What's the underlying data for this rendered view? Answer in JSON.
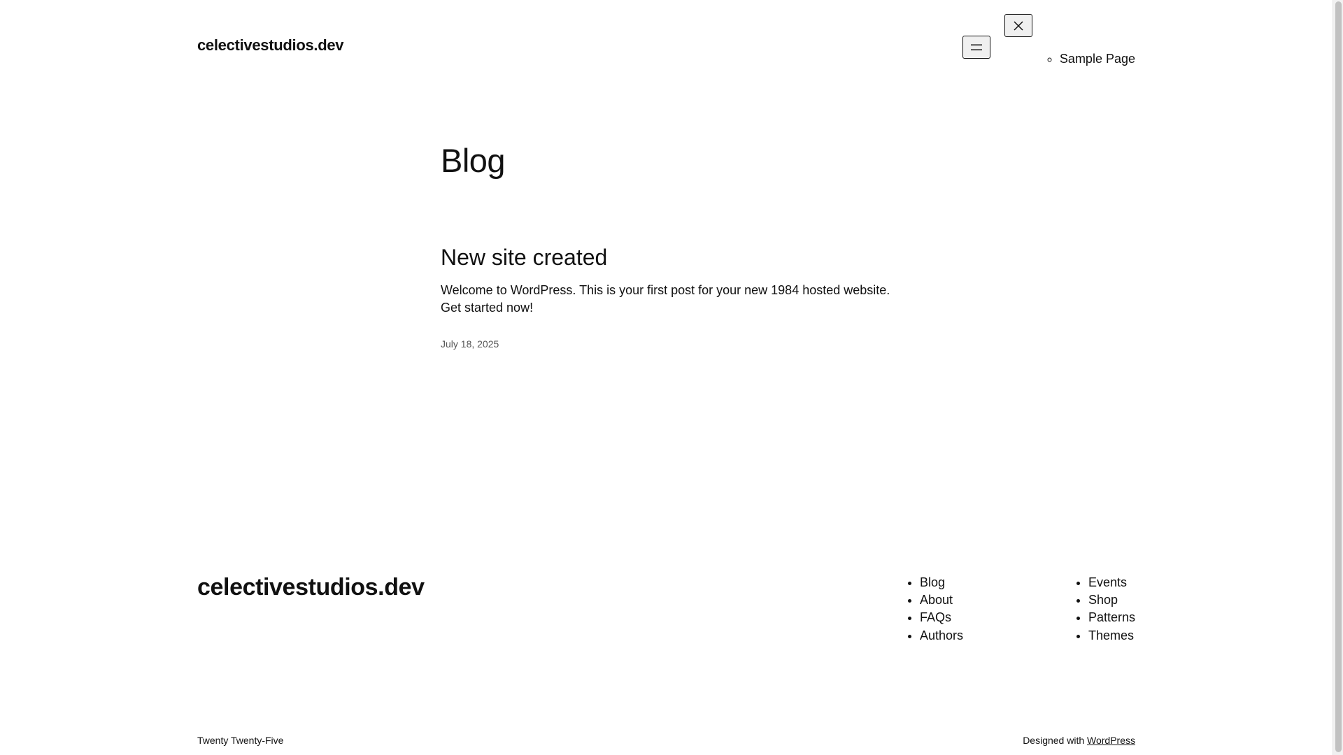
{
  "header": {
    "site_title": "celectivestudios.dev",
    "overlay_menu": [
      {
        "label": "Sample Page"
      }
    ]
  },
  "main": {
    "page_heading": "Blog",
    "posts": [
      {
        "title": "New site created",
        "excerpt": "Welcome to WordPress. This is your first post for your new 1984 hosted website. Get started now!",
        "date": "July 18, 2025"
      }
    ]
  },
  "footer": {
    "site_title": "celectivestudios.dev",
    "nav_col1": [
      "Blog",
      "About",
      "FAQs",
      "Authors"
    ],
    "nav_col2": [
      "Events",
      "Shop",
      "Patterns",
      "Themes"
    ],
    "theme_credit": "Twenty Twenty-Five",
    "designed_with_prefix": "Designed with",
    "designed_with_link": "WordPress"
  },
  "icons": {
    "menu_open": "hamburger-icon",
    "menu_close": "close-icon"
  },
  "colors": {
    "text": "#111111",
    "background": "#ffffff",
    "button_bg": "#f0f0f0"
  }
}
